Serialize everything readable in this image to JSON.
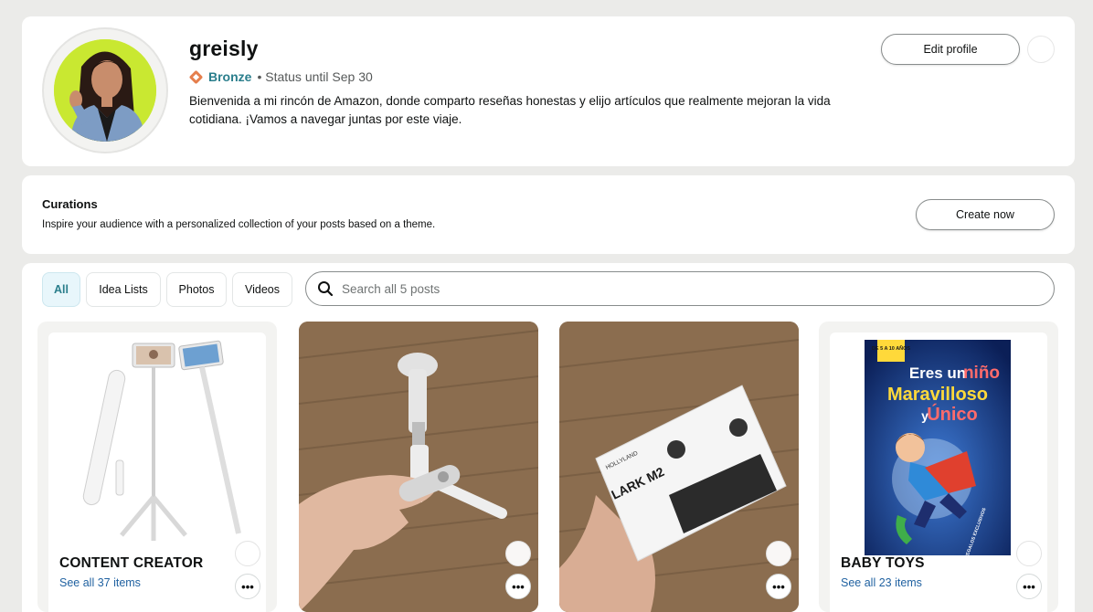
{
  "profile": {
    "username": "greisly",
    "badge_label": "Bronze",
    "status_text": "• Status until Sep 30",
    "bio": "Bienvenida a mi rincón de Amazon, donde comparto reseñas honestas y elijo artículos que realmente mejoran la vida cotidiana. ¡Vamos a navegar juntas por este viaje.",
    "edit_button": "Edit profile",
    "badge_color": "#e57f4d"
  },
  "curations": {
    "title": "Curations",
    "subtitle": "Inspire your audience with a personalized collection of your posts based on a theme.",
    "create_button": "Create now"
  },
  "filters": [
    "All",
    "Idea Lists",
    "Photos",
    "Videos"
  ],
  "search": {
    "placeholder": "Search all 5 posts"
  },
  "posts": [
    {
      "type": "idea-list",
      "title": "CONTENT CREATOR",
      "link": "See all 37 items",
      "more": "•••"
    },
    {
      "type": "photo",
      "more": "•••"
    },
    {
      "type": "photo",
      "product_brand": "HOLLYLAND",
      "product_name": "LARK M2",
      "more": "•••"
    },
    {
      "type": "idea-list",
      "title": "BABY TOYS",
      "link": "See all 23 items",
      "more": "•••",
      "book": {
        "badge": "DE 5 A 10 AÑOS",
        "line1": "Eres un",
        "line2": "niño",
        "line3": "Maravilloso",
        "line4": "y",
        "line5": "Único",
        "corner": "3 REGALOS EXCLUSIVOS"
      }
    }
  ],
  "colors": {
    "accent": "#2a7e8c",
    "link": "#2162a1",
    "page_bg": "#ebebe9"
  }
}
